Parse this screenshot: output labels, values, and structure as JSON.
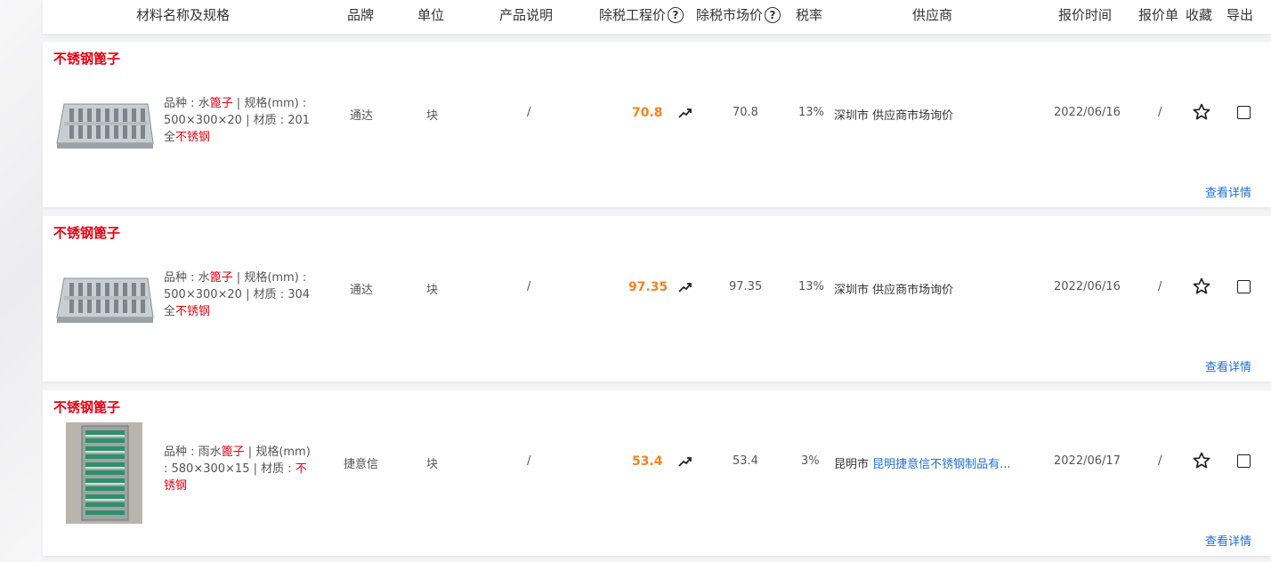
{
  "header": {
    "name_spec": "材料名称及规格",
    "brand": "品牌",
    "unit": "单位",
    "description": "产品说明",
    "eng_price": "除税工程价",
    "market_price": "除税市场价",
    "tax_rate": "税率",
    "supplier": "供应商",
    "quote_time": "报价时间",
    "quote_sheet": "报价单",
    "favorite": "收藏",
    "export": "导出",
    "help_glyph": "?"
  },
  "rows": [
    {
      "title": "不锈钢篦子",
      "desc": {
        "p1": "品种 : 水",
        "h1": "篦子",
        "p2": " | 规格(mm) : 500×300×20 | 材质 : 201全",
        "h2": "不锈钢"
      },
      "brand": "通达",
      "unit": "块",
      "description": "/",
      "eng_price": "70.8",
      "market_price": "70.8",
      "tax_rate": "13%",
      "supplier_city": "深圳市",
      "supplier_name": "供应商市场询价",
      "supplier_is_link": false,
      "quote_time": "2022/06/16",
      "quote_sheet": "/",
      "detail_link": "查看详情",
      "image_icon": "stainless-grate-flat-icon"
    },
    {
      "title": "不锈钢篦子",
      "desc": {
        "p1": "品种 : 水",
        "h1": "篦子",
        "p2": " | 规格(mm) : 500×300×20 | 材质 : 304全",
        "h2": "不锈钢"
      },
      "brand": "通达",
      "unit": "块",
      "description": "/",
      "eng_price": "97.35",
      "market_price": "97.35",
      "tax_rate": "13%",
      "supplier_city": "深圳市",
      "supplier_name": "供应商市场询价",
      "supplier_is_link": false,
      "quote_time": "2022/06/16",
      "quote_sheet": "/",
      "detail_link": "查看详情",
      "image_icon": "stainless-grate-flat-icon"
    },
    {
      "title": "不锈钢篦子",
      "desc": {
        "p1": "品种 : 雨水",
        "h1": "篦子",
        "p2": " | 规格(mm) : 580×300×15 | 材质 : ",
        "h2": "不锈钢"
      },
      "brand": "捷意信",
      "unit": "块",
      "description": "/",
      "eng_price": "53.4",
      "market_price": "53.4",
      "tax_rate": "3%",
      "supplier_city": "昆明市",
      "supplier_name": "昆明捷意信不锈钢制品有...",
      "supplier_is_link": true,
      "quote_time": "2022/06/17",
      "quote_sheet": "/",
      "detail_link": "查看详情",
      "image_icon": "stainless-grate-green-photo-icon"
    }
  ],
  "colors": {
    "title_red": "#e60012",
    "price_orange": "#f5821f",
    "link_blue": "#1f6fd6"
  }
}
